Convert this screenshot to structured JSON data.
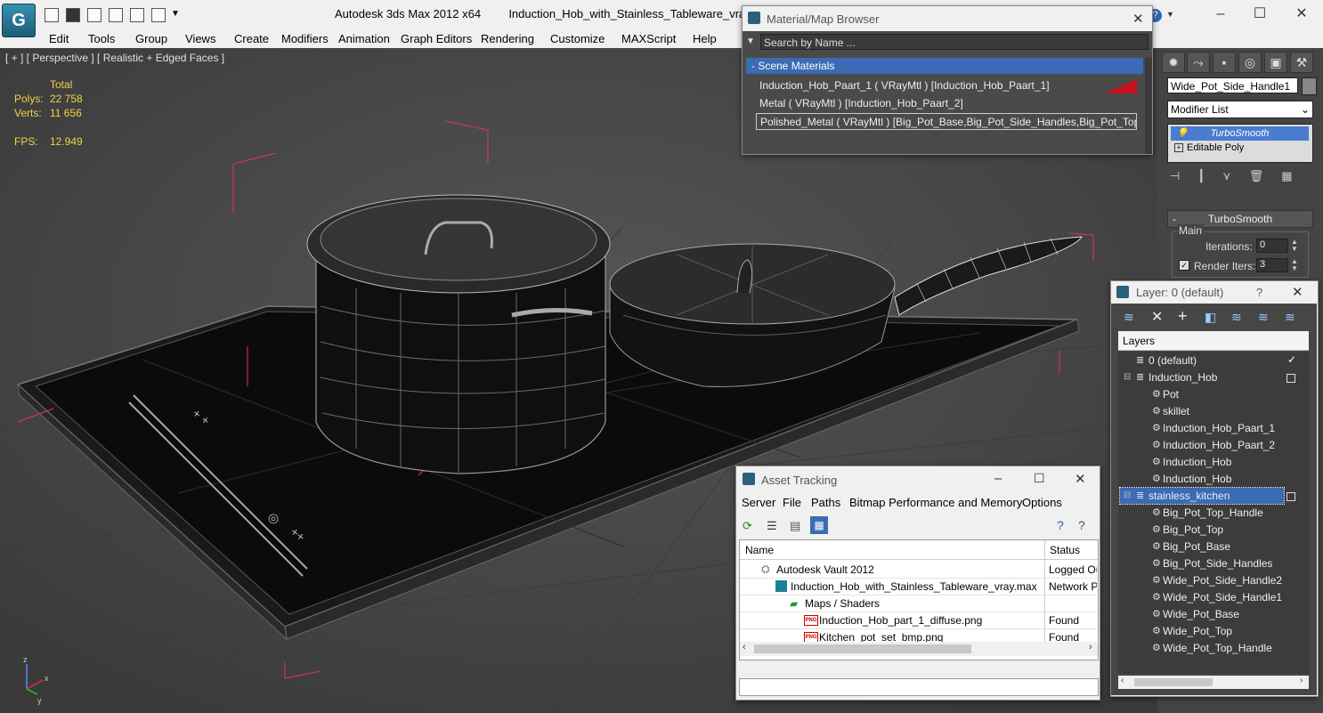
{
  "titlebar": {
    "app_title": "Autodesk 3ds Max  2012 x64",
    "file_name": "Induction_Hob_with_Stainless_Tableware_vray.max",
    "logo_glyph": "G"
  },
  "menubar": [
    "Edit",
    "Tools",
    "Group",
    "Views",
    "Create",
    "Modifiers",
    "Animation",
    "Graph Editors",
    "Rendering",
    "Customize",
    "MAXScript",
    "Help"
  ],
  "viewport": {
    "label": "[ + ] [ Perspective ] [ Realistic + Edged Faces ]",
    "stats": {
      "total_label": "Total",
      "polys_label": "Polys:",
      "polys_value": "22 758",
      "verts_label": "Verts:",
      "verts_value": "11 656",
      "fps_label": "FPS:",
      "fps_value": "12.949"
    },
    "axis": {
      "z": "z",
      "x": "x",
      "y": "y"
    }
  },
  "material_browser": {
    "title": "Material/Map Browser",
    "search_placeholder": "Search by Name ...",
    "section": "- Scene Materials",
    "items": [
      "Induction_Hob_Paart_1  ( VRayMtl )  [Induction_Hob_Paart_1]",
      "Metal  ( VRayMtl )  [Induction_Hob_Paart_2]",
      "Polished_Metal ( VRayMtl ) [Big_Pot_Base,Big_Pot_Side_Handles,Big_Pot_Top,..."
    ],
    "accent_color": "#c8101e"
  },
  "command_panel": {
    "object_name": "Wide_Pot_Side_Handle1",
    "modifier_list": "Modifier List",
    "stack": [
      {
        "label": "TurboSmooth",
        "selected": true
      },
      {
        "label": "Editable Poly",
        "selected": false
      }
    ],
    "rollout_title": "TurboSmooth",
    "group_label": "Main",
    "iterations_label": "Iterations:",
    "iterations_value": "0",
    "render_iters_label": "Render Iters:",
    "render_iters_value": "3",
    "render_iters_checked": true
  },
  "layer_panel": {
    "title": "Layer: 0 (default)",
    "help": "?",
    "header": "Layers",
    "rows": [
      {
        "label": "0 (default)",
        "indent": 0,
        "mark": "check"
      },
      {
        "label": "Induction_Hob",
        "indent": 0,
        "mark": "box"
      },
      {
        "label": "Pot",
        "indent": 1
      },
      {
        "label": "skillet",
        "indent": 1
      },
      {
        "label": "Induction_Hob_Paart_1",
        "indent": 1
      },
      {
        "label": "Induction_Hob_Paart_2",
        "indent": 1
      },
      {
        "label": "Induction_Hob",
        "indent": 1
      },
      {
        "label": "Induction_Hob",
        "indent": 1
      },
      {
        "label": "stainless_kitchen",
        "indent": 0,
        "mark": "box",
        "selected": true
      },
      {
        "label": "Big_Pot_Top_Handle",
        "indent": 1
      },
      {
        "label": "Big_Pot_Top",
        "indent": 1
      },
      {
        "label": "Big_Pot_Base",
        "indent": 1
      },
      {
        "label": "Big_Pot_Side_Handles",
        "indent": 1
      },
      {
        "label": "Wide_Pot_Side_Handle2",
        "indent": 1
      },
      {
        "label": "Wide_Pot_Side_Handle1",
        "indent": 1
      },
      {
        "label": "Wide_Pot_Base",
        "indent": 1
      },
      {
        "label": "Wide_Pot_Top",
        "indent": 1
      },
      {
        "label": "Wide_Pot_Top_Handle",
        "indent": 1
      }
    ]
  },
  "asset_tracking": {
    "title": "Asset Tracking",
    "menu": [
      "Server",
      "File",
      "Paths",
      "Bitmap Performance and Memory",
      "Options"
    ],
    "columns": [
      "Name",
      "Status"
    ],
    "rows": [
      {
        "name": "Autodesk Vault 2012",
        "status": "Logged Ou",
        "indent": 1,
        "icon": "vault-icon"
      },
      {
        "name": "Induction_Hob_with_Stainless_Tableware_vray.max",
        "status": "Network P",
        "indent": 2,
        "icon": "max-file-icon"
      },
      {
        "name": "Maps / Shaders",
        "status": "",
        "indent": 3,
        "icon": "maps-icon"
      },
      {
        "name": "Induction_Hob_part_1_diffuse.png",
        "status": "Found",
        "indent": 4,
        "icon": "png-icon"
      },
      {
        "name": "Kitchen_pot_set_bmp.png",
        "status": "Found",
        "indent": 4,
        "icon": "png-icon"
      }
    ],
    "png_badge": "PNG"
  }
}
